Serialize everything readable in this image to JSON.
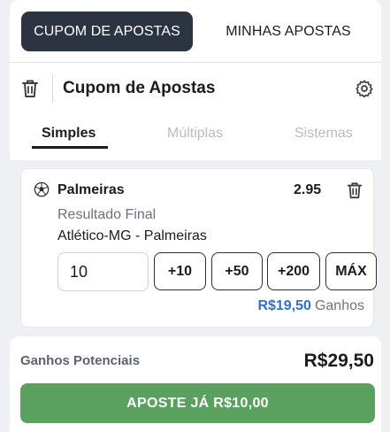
{
  "top_tabs": {
    "active_label": "CUPOM DE APOSTAS",
    "inactive_label": "MINHAS APOSTAS"
  },
  "header": {
    "title": "Cupom de Apostas",
    "left_icon": "trash-icon",
    "right_icon": "gear-icon"
  },
  "bet_type_tabs": [
    {
      "label": "Simples",
      "state": "active"
    },
    {
      "label": "Múltiplas",
      "state": "disabled"
    },
    {
      "label": "Sistemas",
      "state": "disabled"
    }
  ],
  "bet": {
    "selection": "Palmeiras",
    "odds": "2.95",
    "market": "Resultado Final",
    "match": "Atlético-MG - Palmeiras",
    "stake_value": "10",
    "quick_stakes": [
      "+10",
      "+50",
      "+200",
      "MÁX"
    ],
    "winnings_amount": "R$19,50",
    "winnings_label": "Ganhos"
  },
  "footer": {
    "potential_label": "Ganhos Potenciais",
    "potential_value": "R$29,50",
    "place_button": "APOSTE JÁ R$10,00"
  },
  "colors": {
    "active_tab_bg": "#2c3441",
    "accent_blue": "#2f6fcf",
    "place_button_bg": "#5aa05e"
  }
}
